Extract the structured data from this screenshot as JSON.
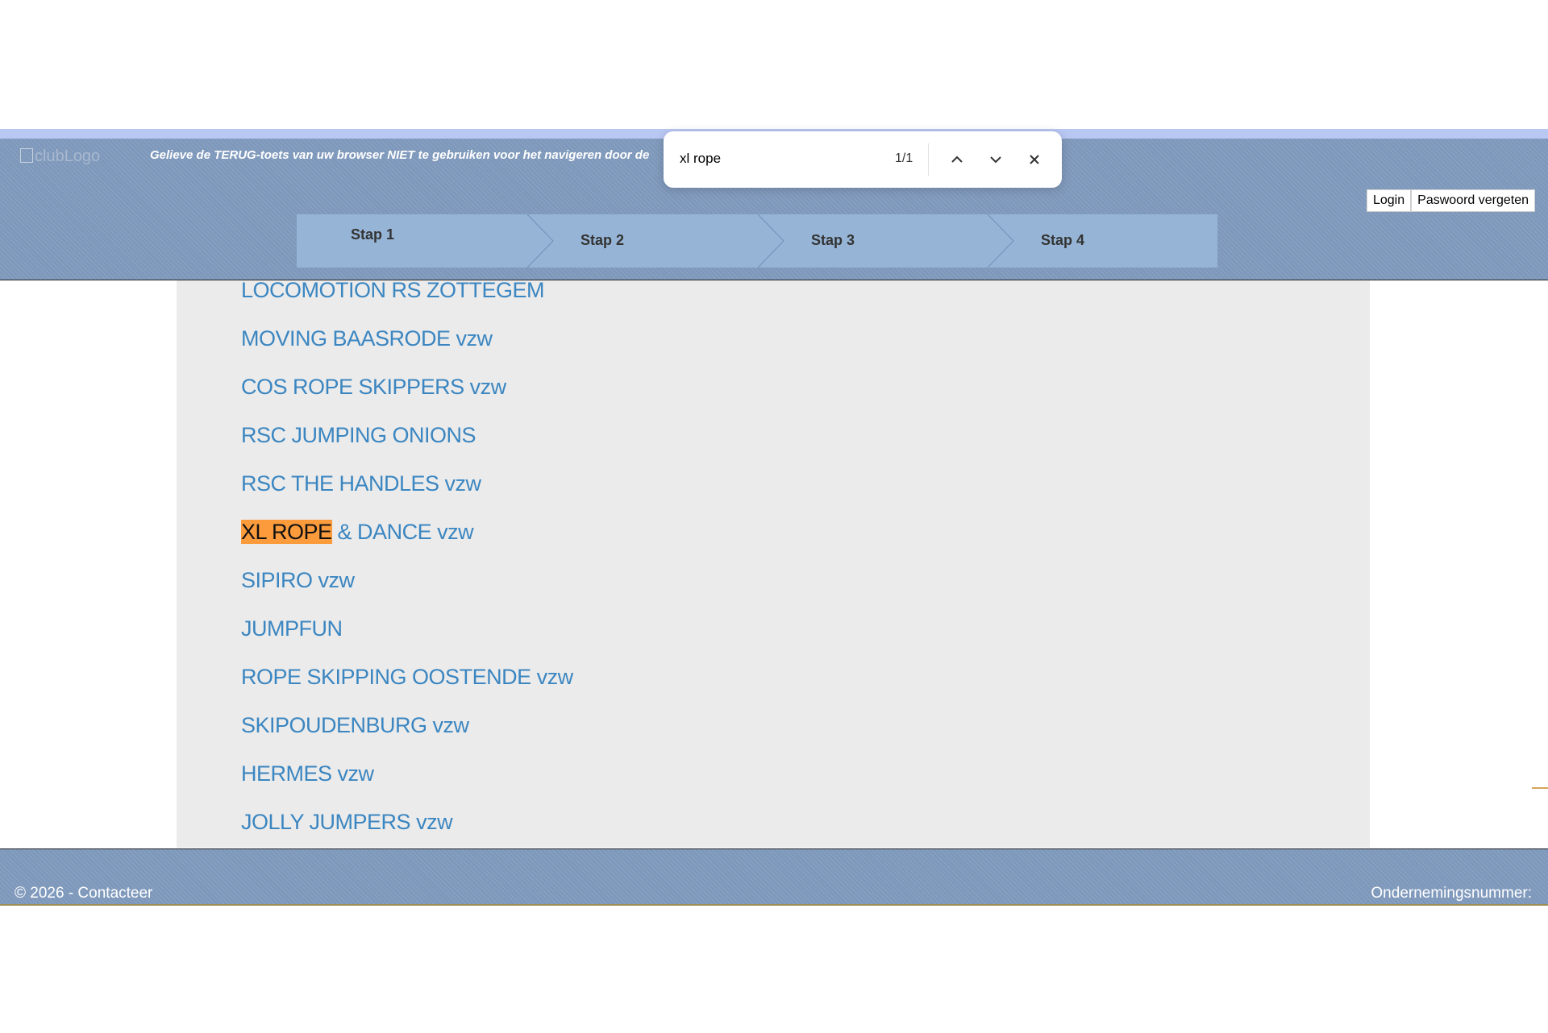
{
  "header": {
    "logo_alt": "clubLogo",
    "notice": "Gelieve de TERUG-toets van uw browser NIET te gebruiken voor het navigeren door de",
    "login_label": "Login",
    "forgot_password_label": "Paswoord vergeten",
    "steps": [
      "Stap 1",
      "Stap 2",
      "Stap 3",
      "Stap 4"
    ],
    "step_color": "#96b5d6"
  },
  "clubs": [
    "LOCOMOTION RS ZOTTEGEM",
    "MOVING BAASRODE vzw",
    "COS ROPE SKIPPERS vzw",
    "RSC JUMPING ONIONS",
    "RSC THE HANDLES vzw",
    {
      "highlight": "XL ROPE",
      "rest": " & DANCE vzw"
    },
    "SIPIRO vzw",
    "JUMPFUN",
    "ROPE SKIPPING OOSTENDE vzw",
    "SKIPOUDENBURG vzw",
    "HERMES vzw",
    "JOLLY JUMPERS vzw"
  ],
  "find_bar": {
    "query": "xl rope",
    "match_count": "1/1",
    "highlight_color": "#fb9b3c"
  },
  "footer": {
    "copyright": "© 2026 - Contacteer",
    "company_number": "Ondernemingsnummer:"
  }
}
